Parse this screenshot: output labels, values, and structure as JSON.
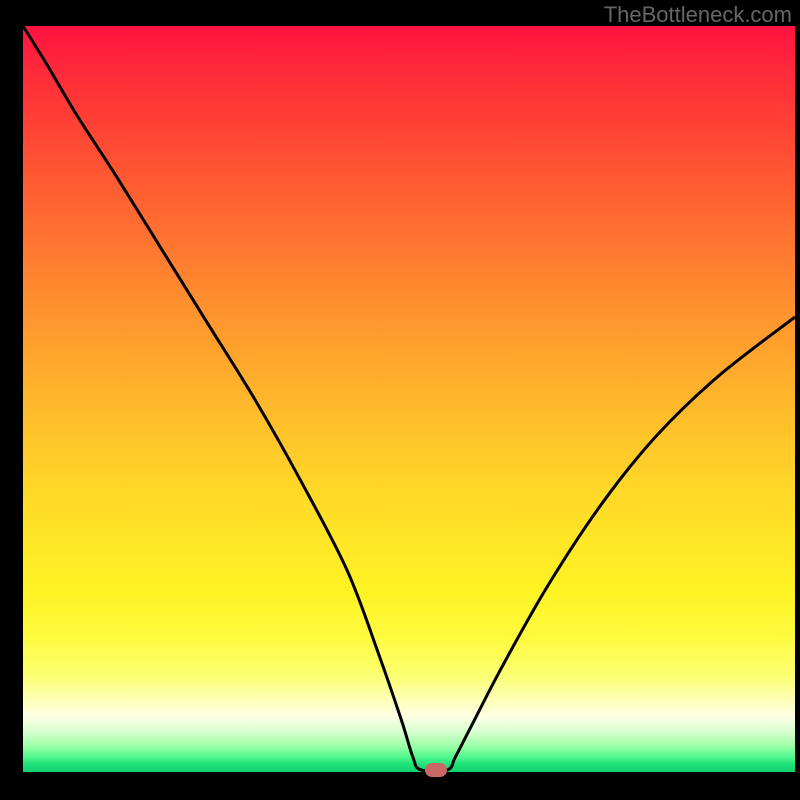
{
  "attribution": "TheBottleneck.com",
  "chart_data": {
    "type": "line",
    "title": "",
    "xlabel": "",
    "ylabel": "",
    "xlim": [
      0,
      1
    ],
    "ylim": [
      0,
      1
    ],
    "series": [
      {
        "name": "bottleneck-curve",
        "points": [
          {
            "x": 0.0,
            "y": 1.0
          },
          {
            "x": 0.03,
            "y": 0.95
          },
          {
            "x": 0.07,
            "y": 0.88
          },
          {
            "x": 0.12,
            "y": 0.8
          },
          {
            "x": 0.18,
            "y": 0.7
          },
          {
            "x": 0.24,
            "y": 0.6
          },
          {
            "x": 0.3,
            "y": 0.5
          },
          {
            "x": 0.36,
            "y": 0.39
          },
          {
            "x": 0.42,
            "y": 0.27
          },
          {
            "x": 0.46,
            "y": 0.16
          },
          {
            "x": 0.49,
            "y": 0.07
          },
          {
            "x": 0.505,
            "y": 0.02
          },
          {
            "x": 0.515,
            "y": 0.003
          },
          {
            "x": 0.55,
            "y": 0.003
          },
          {
            "x": 0.56,
            "y": 0.02
          },
          {
            "x": 0.58,
            "y": 0.06
          },
          {
            "x": 0.62,
            "y": 0.14
          },
          {
            "x": 0.68,
            "y": 0.25
          },
          {
            "x": 0.75,
            "y": 0.36
          },
          {
            "x": 0.82,
            "y": 0.45
          },
          {
            "x": 0.9,
            "y": 0.53
          },
          {
            "x": 1.0,
            "y": 0.61
          }
        ]
      }
    ],
    "marker": {
      "x": 0.535,
      "y": 0.003
    }
  },
  "colors": {
    "curve": "#000000",
    "marker": "#c96864"
  }
}
